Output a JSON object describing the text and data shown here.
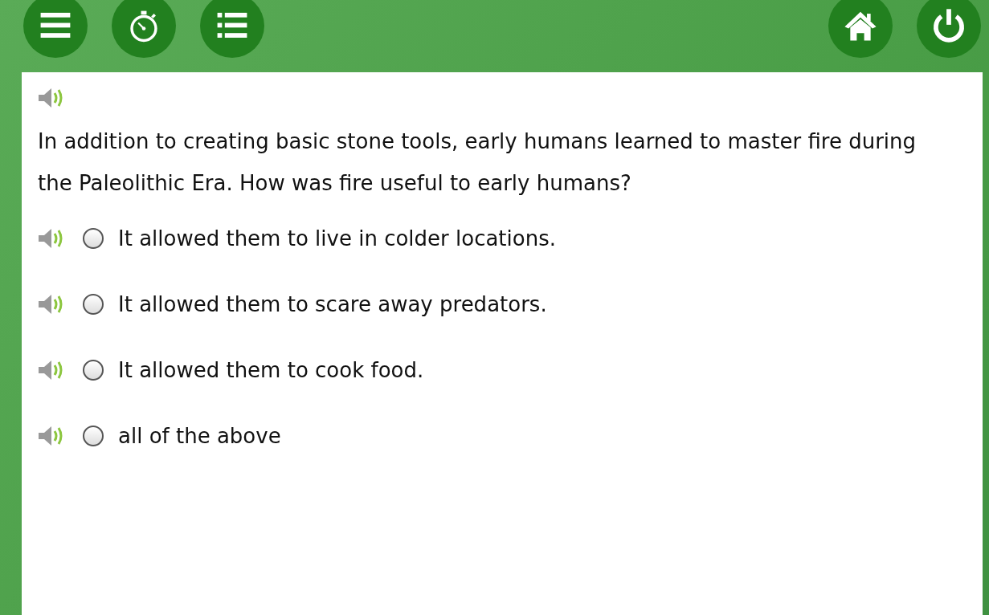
{
  "toolbar": {
    "left": [
      {
        "kind": "menu"
      },
      {
        "kind": "timer"
      },
      {
        "kind": "list"
      }
    ],
    "right": [
      {
        "kind": "home"
      },
      {
        "kind": "power"
      }
    ]
  },
  "question": {
    "text": "In addition to creating basic stone tools, early humans learned to master fire during the Paleolithic Era. How was fire useful to early humans?"
  },
  "options": [
    {
      "text": "It allowed them to live in colder locations.",
      "selected": false
    },
    {
      "text": "It allowed them to scare away predators.",
      "selected": false
    },
    {
      "text": "It allowed them to cook food.",
      "selected": false
    },
    {
      "text": "all of the above",
      "selected": false
    }
  ]
}
